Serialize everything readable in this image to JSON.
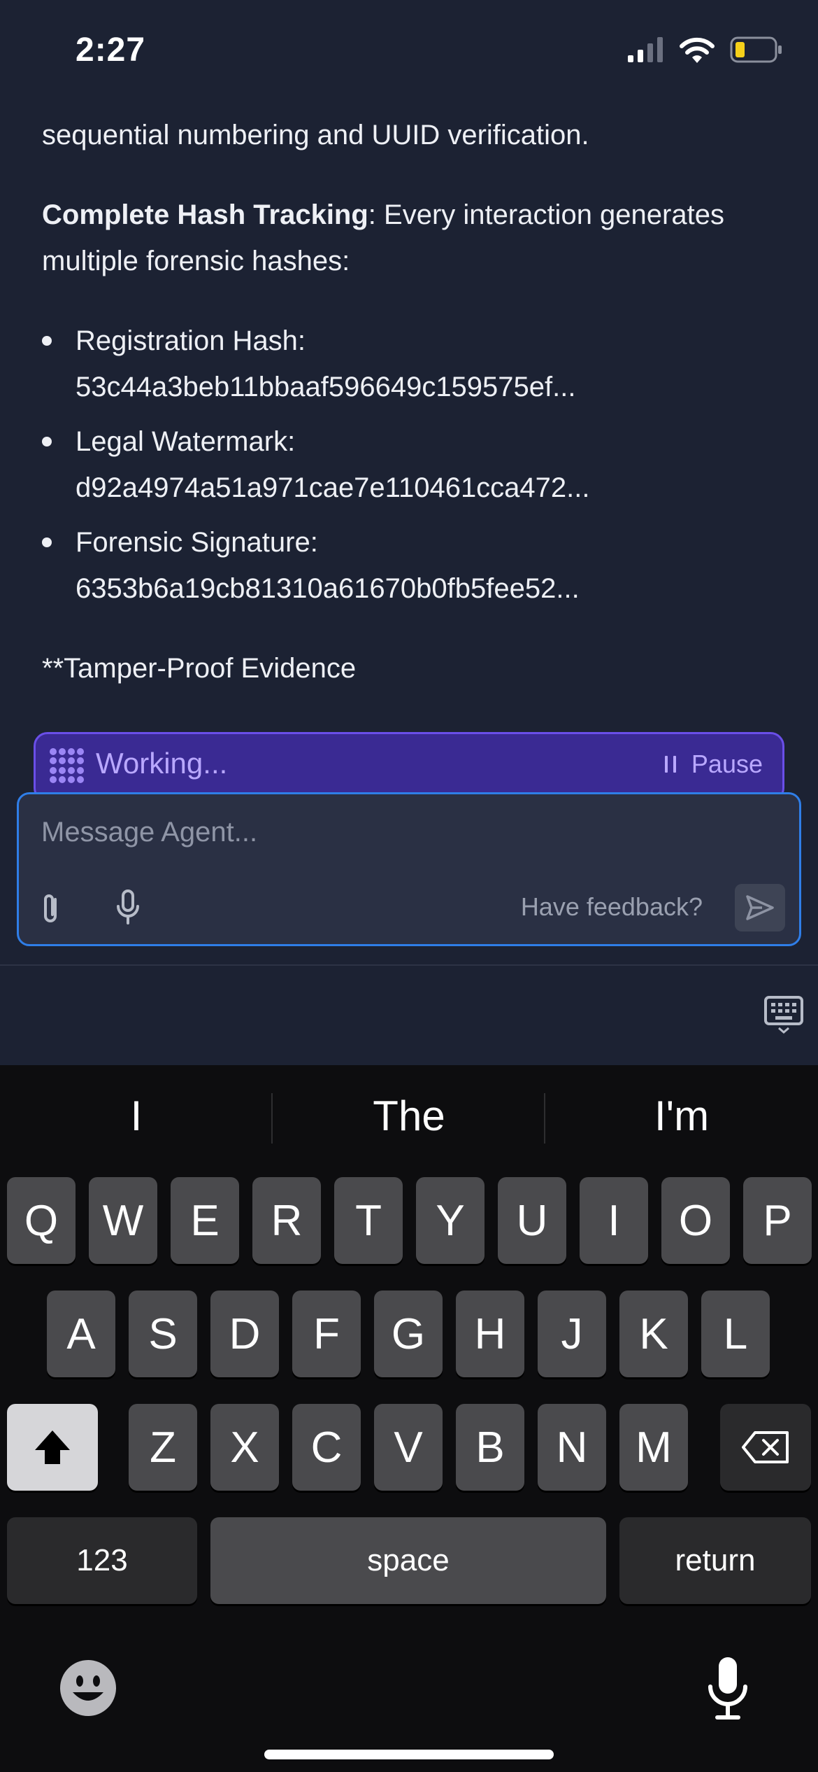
{
  "status_bar": {
    "time": "2:27"
  },
  "chat": {
    "intro_line": "sequential numbering and UUID verification.",
    "hash_heading_bold": "Complete Hash Tracking",
    "hash_heading_rest": ": Every interaction generates multiple forensic hashes:",
    "hashes": [
      {
        "label": "Registration Hash:",
        "value": "53c44a3beb11bbaaf596649c159575ef..."
      },
      {
        "label": "Legal Watermark:",
        "value": "d92a4974a51a971cae7e110461cca472..."
      },
      {
        "label": "Forensic Signature:",
        "value": "6353b6a19cb81310a61670b0fb5fee52..."
      }
    ],
    "trailing_line": "**Tamper-Proof Evidence"
  },
  "working_banner": {
    "label": "Working...",
    "pause_label": "Pause"
  },
  "composer": {
    "placeholder": "Message Agent...",
    "feedback_label": "Have feedback?"
  },
  "keyboard": {
    "suggestions": [
      "I",
      "The",
      "I'm"
    ],
    "row1": [
      "Q",
      "W",
      "E",
      "R",
      "T",
      "Y",
      "U",
      "I",
      "O",
      "P"
    ],
    "row2": [
      "A",
      "S",
      "D",
      "F",
      "G",
      "H",
      "J",
      "K",
      "L"
    ],
    "row3": [
      "Z",
      "X",
      "C",
      "V",
      "B",
      "N",
      "M"
    ],
    "numbers_label": "123",
    "space_label": "space",
    "return_label": "return"
  },
  "colors": {
    "background": "#1c2233",
    "accent_purple": "#3a2a93",
    "focus_blue": "#2f7ee8",
    "keyboard_bg": "#0d0d0f"
  }
}
